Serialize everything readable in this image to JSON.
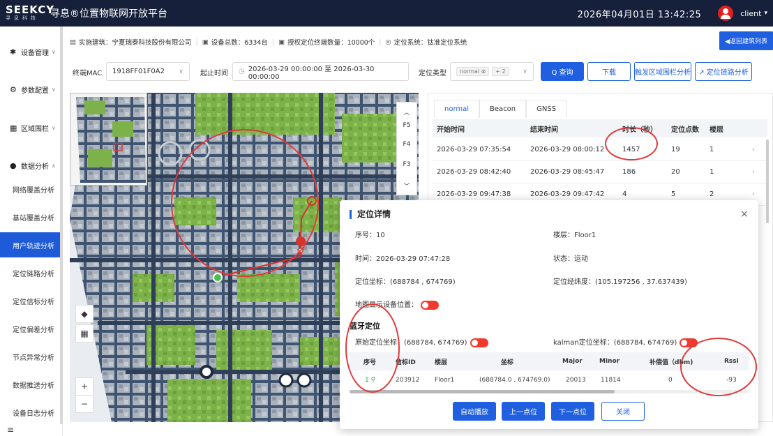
{
  "header": {
    "logo_main": "SEEKCY",
    "logo_sub": "寻息科技",
    "title": "寻息®位置物联网开放平台",
    "datetime": "2026年04月01日   13:42:25",
    "user": "client",
    "caret": "▾"
  },
  "sidebar": {
    "groups": [
      {
        "icon": "✱",
        "label": "设备管理",
        "caret": "∨"
      },
      {
        "icon": "⚙",
        "label": "参数配置",
        "caret": "∨"
      },
      {
        "icon": "▦",
        "label": "区域围栏",
        "caret": "∨"
      },
      {
        "icon": "●",
        "label": "数据分析",
        "caret": "∧"
      }
    ],
    "items": [
      "网络覆盖分析",
      "基站覆盖分析",
      "用户轨迹分析",
      "定位链路分析",
      "定位信标分析",
      "定位偏差分析",
      "节点异常分析",
      "数据推送分析",
      "设备日志分析"
    ],
    "active_index": 2,
    "bottom_icon": "≡"
  },
  "infobar": {
    "building": "实施建筑：宁夏瑞泰科技股份有限公司",
    "device_total": "设备总数：6334台",
    "license": "授权定位终端数量：10000个",
    "system": "定位系统：钛准定位系统",
    "back_label": "◀返回建筑列表",
    "sep": "|"
  },
  "filter": {
    "mac_label": "终端MAC",
    "mac_value": "1918FF01F0A2",
    "time_label": "起止时间",
    "time_value": "2026-03-29 00:00:00 至 2026-03-30 00:00:00",
    "type_label": "定位类型",
    "type_tag": "normal ⊗",
    "type_more": "+ 2",
    "query": "Q 查询",
    "download": "下载",
    "trigger": "触发区域围栏分析",
    "link": "↗ 定位链路分析"
  },
  "map": {
    "floors": [
      "F5",
      "F4",
      "F3"
    ],
    "up": "︿",
    "down": "﹀",
    "zoom_in": "+",
    "zoom_out": "−",
    "tool1": "◆",
    "tool2": "▦"
  },
  "panel": {
    "tabs": [
      "normal",
      "Beacon",
      "GNSS"
    ],
    "active_tab": 0,
    "columns": [
      "开始时间",
      "结束时间",
      "时长（秒）",
      "定位点数",
      "楼层"
    ],
    "rows": [
      {
        "start": "2026-03-29 07:35:54",
        "end": "2026-03-29 08:00:12",
        "duration": "1457",
        "points": "19",
        "floor": "1"
      },
      {
        "start": "2026-03-29 08:42:40",
        "end": "2026-03-29 08:45:47",
        "duration": "186",
        "points": "20",
        "floor": "1"
      },
      {
        "start": "2026-03-29 09:47:38",
        "end": "2026-03-29 09:47:42",
        "duration": "4",
        "points": "5",
        "floor": "2"
      }
    ],
    "row_arrow": "›"
  },
  "dialog": {
    "title": "定位详情",
    "close": "×",
    "seq": "序号：10",
    "floor": "楼层：Floor1",
    "time": "时间：2026-03-29 07:47:28",
    "status": "状态：运动",
    "coord": "定位坐标：(688784 , 674769)",
    "lnglat": "定位经纬度：(105.197256 , 37.637439)",
    "map_show": "地图显示设备位置：",
    "section": "蓝牙定位",
    "raw_coord": "原始定位坐标：(688784, 674769)",
    "kalman_coord": "kalman定位坐标：(688784, 674769)",
    "columns": [
      "序号",
      "信标ID",
      "楼层",
      "坐标",
      "Major",
      "Minor",
      "补偿值（dbm)",
      "Rssi"
    ],
    "row": {
      "seq": "1",
      "beacon_id": "203912",
      "floor": "Floor1",
      "coord": "(688784.0 , 674769.0)",
      "major": "20013",
      "minor": "11814",
      "comp": "0",
      "rssi": "-93"
    },
    "buttons": {
      "auto": "自动播放",
      "prev": "上一点位",
      "next": "下一点位",
      "close": "关闭"
    }
  },
  "colors": {
    "brand": "#1f5fe0",
    "header": "#16203a",
    "annotation": "#e0393a",
    "toggle": "#f03a2e"
  }
}
